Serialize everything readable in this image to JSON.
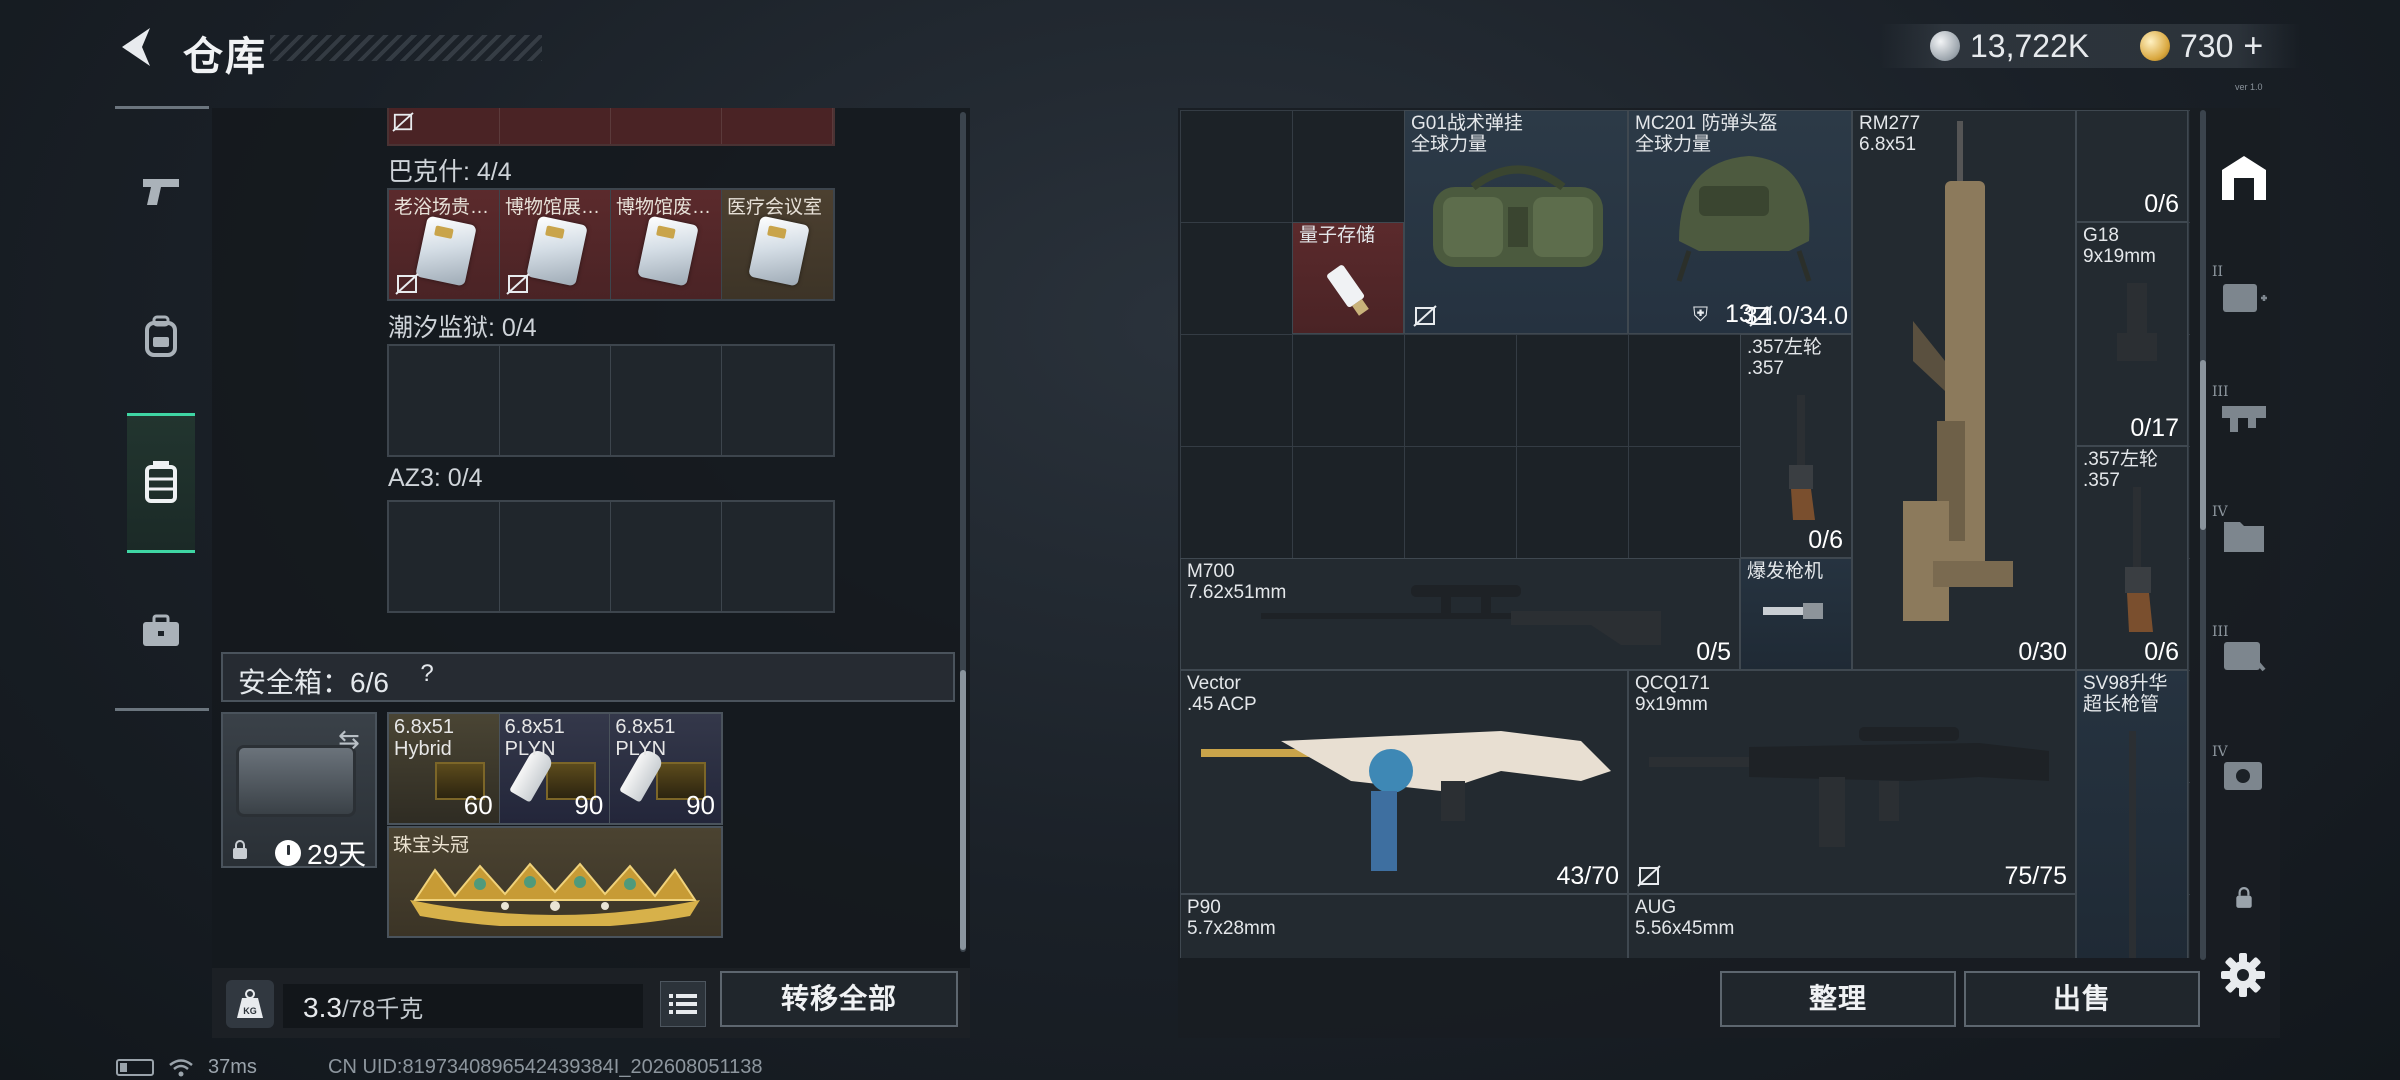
{
  "header": {
    "title": "仓库",
    "currency1": "13,722K",
    "currency2": "730",
    "currency2_plus": "+",
    "tiny_tag": "ver 1.0"
  },
  "left": {
    "groups": [
      {
        "label": "巴克什: 4/4",
        "items": [
          "老浴场贵…",
          "博物馆展…",
          "博物馆废…",
          "医疗会议室"
        ]
      },
      {
        "label": "潮汐监狱: 0/4"
      },
      {
        "label": "AZ3: 0/4"
      }
    ],
    "safe": {
      "label": "安全箱：6/6",
      "help": "?",
      "days": "29天",
      "ammo": [
        {
          "name1": "6.8x51",
          "name2": "Hybrid",
          "count": "60"
        },
        {
          "name1": "6.8x51",
          "name2": "PLYN",
          "count": "90"
        },
        {
          "name1": "6.8x51",
          "name2": "PLYN",
          "count": "90"
        }
      ],
      "crown": "珠宝头冠"
    },
    "weight_value": "3.3",
    "weight_unit": "/78千克",
    "transfer_all": "转移全部"
  },
  "status": {
    "ping": "37ms",
    "uid": "CN UID:8197340896542439384I_202608051138"
  },
  "right": {
    "items": {
      "quantum": {
        "name": "量子存储"
      },
      "bag": {
        "name1": "G01战术弹挂",
        "name2": "全球力量"
      },
      "helmet": {
        "name1": "MC201 防弹头盔",
        "name2": "全球力量",
        "count_a": "13",
        "count_b": "34.0/34.0"
      },
      "rm277": {
        "name1": "RM277",
        "name2": "6.8x51",
        "count": "0/30"
      },
      "top_right": {
        "count": "0/6"
      },
      "g18": {
        "name1": "G18",
        "name2": "9x19mm",
        "count": "0/17"
      },
      "rev1": {
        "name1": ".357左轮",
        "name2": ".357",
        "count": "0/6"
      },
      "rev2": {
        "name1": ".357左轮",
        "name2": ".357",
        "count": "0/6"
      },
      "m700": {
        "name1": "M700",
        "name2": "7.62x51mm",
        "count": "0/5"
      },
      "burst": {
        "name1": "爆发枪机"
      },
      "vector": {
        "name1": "Vector",
        "name2": ".45 ACP",
        "count": "43/70"
      },
      "qcq": {
        "name1": "QCQ171",
        "name2": "9x19mm",
        "count": "75/75"
      },
      "sv98": {
        "name1": "SV98升华",
        "name2": "超长枪管"
      },
      "p90": {
        "name1": "P90",
        "name2": "5.7x28mm"
      },
      "aug": {
        "name1": "AUG",
        "name2": "5.56x45mm"
      }
    },
    "side_tiers": [
      "II",
      "III",
      "IV",
      "III",
      "IV"
    ],
    "sort": "整理",
    "sell": "出售"
  },
  "colors": {
    "accent_green": "#3fd6a4",
    "slot_red": "#4a2325",
    "slot_blue": "#2c3a47"
  },
  "icons": [
    "back-arrow-icon",
    "silver-coin-icon",
    "gold-coin-icon",
    "pistol-icon",
    "backpack-icon",
    "chest-rig-icon",
    "briefcase-icon",
    "no-sell-icon",
    "lock-icon",
    "clock-icon",
    "swap-icon",
    "list-icon",
    "kg-icon",
    "battery-icon",
    "wifi-icon",
    "warehouse-icon",
    "medkit-icon",
    "gear-icon"
  ]
}
